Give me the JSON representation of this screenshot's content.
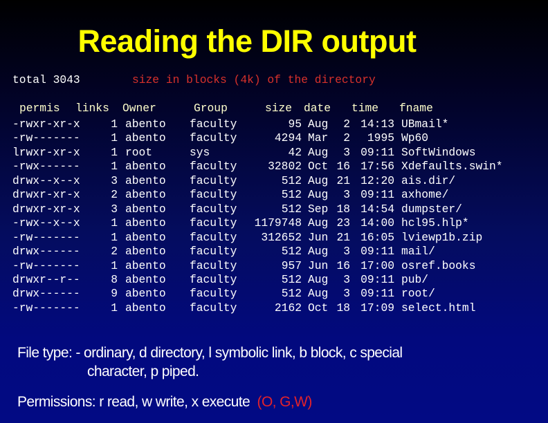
{
  "title": "Reading the DIR output",
  "total": {
    "label": "total 3043",
    "note": "size in blocks (4k) of the directory"
  },
  "columns": {
    "permis": "permis",
    "links": "links",
    "owner": "Owner",
    "group": "Group",
    "size": "size",
    "date": "date",
    "time": "time",
    "fname": "fname"
  },
  "rows": [
    {
      "permis": "-rwxr-xr-x",
      "links": "1",
      "owner": "abento",
      "group": "faculty",
      "size": "95",
      "month": "Aug",
      "day": "2",
      "time": "14:13",
      "fname": "UBmail*"
    },
    {
      "permis": "-rw-------",
      "links": "1",
      "owner": "abento",
      "group": "faculty",
      "size": "4294",
      "month": "Mar",
      "day": "2",
      "time": "1995",
      "fname": "Wp60"
    },
    {
      "permis": "lrwxr-xr-x",
      "links": "1",
      "owner": "root",
      "group": "sys",
      "size": "42",
      "month": "Aug",
      "day": "3",
      "time": "09:11",
      "fname": "SoftWindows"
    },
    {
      "permis": "-rwx------",
      "links": "1",
      "owner": "abento",
      "group": "faculty",
      "size": "32802",
      "month": "Oct",
      "day": "16",
      "time": "17:56",
      "fname": "Xdefaults.swin*"
    },
    {
      "permis": "drwx--x--x",
      "links": "3",
      "owner": "abento",
      "group": "faculty",
      "size": "512",
      "month": "Aug",
      "day": "21",
      "time": "12:20",
      "fname": "ais.dir/"
    },
    {
      "permis": "drwxr-xr-x",
      "links": "2",
      "owner": "abento",
      "group": "faculty",
      "size": "512",
      "month": "Aug",
      "day": "3",
      "time": "09:11",
      "fname": "axhome/"
    },
    {
      "permis": "drwxr-xr-x",
      "links": "3",
      "owner": "abento",
      "group": "faculty",
      "size": "512",
      "month": "Sep",
      "day": "18",
      "time": "14:54",
      "fname": "dumpster/"
    },
    {
      "permis": "-rwx--x--x",
      "links": "1",
      "owner": "abento",
      "group": "faculty",
      "size": "1179748",
      "month": "Aug",
      "day": "23",
      "time": "14:00",
      "fname": "hcl95.hlp*"
    },
    {
      "permis": "-rw-------",
      "links": "1",
      "owner": "abento",
      "group": "faculty",
      "size": "312652",
      "month": "Jun",
      "day": "21",
      "time": "16:05",
      "fname": "lviewp1b.zip"
    },
    {
      "permis": "drwx------",
      "links": "2",
      "owner": "abento",
      "group": "faculty",
      "size": "512",
      "month": "Aug",
      "day": "3",
      "time": "09:11",
      "fname": "mail/"
    },
    {
      "permis": "-rw-------",
      "links": "1",
      "owner": "abento",
      "group": "faculty",
      "size": "957",
      "month": "Jun",
      "day": "16",
      "time": "17:00",
      "fname": "osref.books"
    },
    {
      "permis": "drwxr--r--",
      "links": "8",
      "owner": "abento",
      "group": "faculty",
      "size": "512",
      "month": "Aug",
      "day": "3",
      "time": "09:11",
      "fname": "pub/"
    },
    {
      "permis": "drwx------",
      "links": "9",
      "owner": "abento",
      "group": "faculty",
      "size": "512",
      "month": "Aug",
      "day": "3",
      "time": "09:11",
      "fname": "root/"
    },
    {
      "permis": "-rw-------",
      "links": "1",
      "owner": "abento",
      "group": "faculty",
      "size": "2162",
      "month": "Oct",
      "day": "18",
      "time": "17:09",
      "fname": "select.html"
    }
  ],
  "notes": {
    "file_type_line1": "File type: - ordinary, d directory, l symbolic link, b block, c special",
    "file_type_line2": "character, p piped.",
    "permissions_text": "Permissions: r read, w write, x execute",
    "permissions_scope": "(O, G,W)"
  },
  "colors": {
    "title": "#ffff00",
    "header": "#ffffcc",
    "annotation_red": "#d8312b",
    "text": "#ffffff"
  }
}
